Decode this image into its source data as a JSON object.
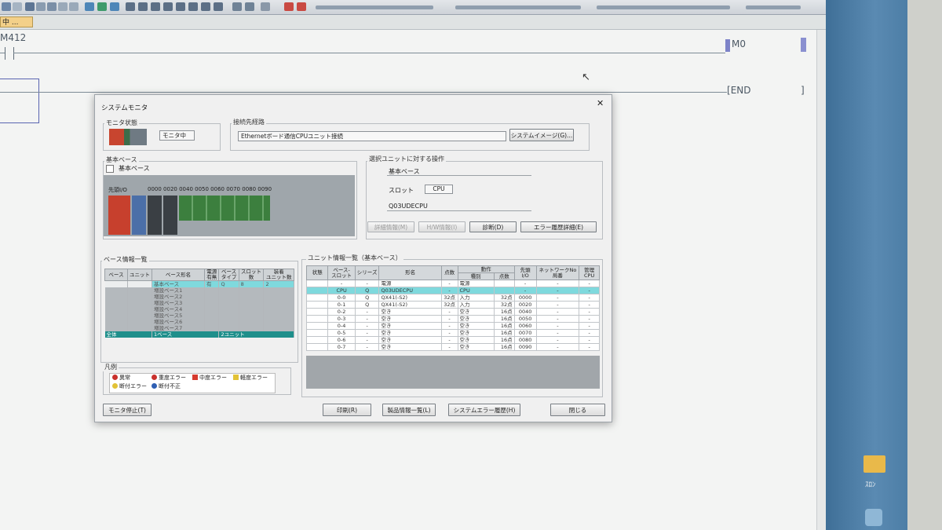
{
  "ladder": {
    "contact_label": "M412",
    "coil_label": "M0",
    "end_label": "END"
  },
  "tab": {
    "label": "中 ..."
  },
  "dialog": {
    "title": "システムモニタ",
    "close_glyph": "✕",
    "monitor_status": {
      "title": "モニタ状態",
      "value": "モニタ中"
    },
    "connection": {
      "title": "接続先経路",
      "value": "Ethernetボード通信CPUユニット接続",
      "button": "システムイメージ(G)..."
    },
    "base": {
      "title": "基本ベース",
      "checkbox_label": "基本ベース",
      "io_label": "先頭I/O",
      "io_addresses": "0000 0020 0040 0050 0060 0070 0080 0090"
    },
    "operation": {
      "title": "選択ユニットに対する操作",
      "base_name": "基本ベース",
      "slot_label": "スロット",
      "slot_value": "CPU",
      "model": "Q03UDECPU",
      "buttons": {
        "detail": "詳細情報(M)",
        "hw": "H/W情報(I)",
        "diagnose": "診断(D)",
        "error_history": "エラー履歴詳細(E)"
      }
    },
    "base_list": {
      "title": "ベース情報一覧",
      "headers": [
        "ベース",
        "ユニット",
        "ベース形名",
        "電源\n有無",
        "ベース\nタイプ",
        "スロット\n数",
        "装着\nユニット数"
      ],
      "rows": [
        [
          "",
          "",
          "基本ベース",
          "有",
          "Q",
          "8",
          "2"
        ],
        [
          "",
          "",
          "増設ベース1",
          "",
          "",
          "",
          ""
        ],
        [
          "",
          "",
          "増設ベース2",
          "",
          "",
          "",
          ""
        ],
        [
          "",
          "",
          "増設ベース3",
          "",
          "",
          "",
          ""
        ],
        [
          "",
          "",
          "増設ベース4",
          "",
          "",
          "",
          ""
        ],
        [
          "",
          "",
          "増設ベース5",
          "",
          "",
          "",
          ""
        ],
        [
          "",
          "",
          "増設ベース6",
          "",
          "",
          "",
          ""
        ],
        [
          "",
          "",
          "増設ベース7",
          "",
          "",
          "",
          ""
        ]
      ],
      "total_row": {
        "label": "全体",
        "base_count": "1ベース",
        "unit_count": "2ユニット"
      }
    },
    "unit_list": {
      "title": "ユニット情報一覧（基本ベース）",
      "headers": {
        "status": "状態",
        "slot": "ベース-\nスロット",
        "series": "シリーズ",
        "model": "形名",
        "points": "点数",
        "action": "動作",
        "action_type": "種別",
        "action_points": "点数",
        "head_io": "先頭\nI/O",
        "network": "ネットワークNo\n局番",
        "cpu": "管理\nCPU"
      },
      "rows": [
        [
          "",
          "-",
          "-",
          "電源",
          "-",
          "電源",
          "",
          "-",
          "-",
          "-"
        ],
        [
          "",
          "CPU",
          "Q",
          "Q03UDECPU",
          "-",
          "CPU",
          "",
          "-",
          "-",
          "-"
        ],
        [
          "",
          "0-0",
          "Q",
          "QX41(-S2)",
          "32点",
          "入力",
          "32点",
          "0000",
          "-",
          "-"
        ],
        [
          "",
          "0-1",
          "Q",
          "QX41(-S2)",
          "32点",
          "入力",
          "32点",
          "0020",
          "-",
          "-"
        ],
        [
          "",
          "0-2",
          "-",
          "空き",
          "-",
          "空き",
          "16点",
          "0040",
          "-",
          "-"
        ],
        [
          "",
          "0-3",
          "-",
          "空き",
          "-",
          "空き",
          "16点",
          "0050",
          "-",
          "-"
        ],
        [
          "",
          "0-4",
          "-",
          "空き",
          "-",
          "空き",
          "16点",
          "0060",
          "-",
          "-"
        ],
        [
          "",
          "0-5",
          "-",
          "空き",
          "-",
          "空き",
          "16点",
          "0070",
          "-",
          "-"
        ],
        [
          "",
          "0-6",
          "-",
          "空き",
          "-",
          "空き",
          "16点",
          "0080",
          "-",
          "-"
        ],
        [
          "",
          "0-7",
          "-",
          "空き",
          "-",
          "空き",
          "16点",
          "0090",
          "-",
          "-"
        ]
      ]
    },
    "legend": {
      "title": "凡例",
      "items": [
        "異常",
        "重度エラー",
        "中度エラー",
        "軽度エラー",
        "断付エラー",
        "断付不正"
      ]
    },
    "buttons": {
      "stop_monitor": "モニタ停止(T)",
      "print": "印刷(R)",
      "product_list": "製品情報一覧(L)",
      "system_error": "システムエラー履歴(H)",
      "close": "閉じる"
    }
  },
  "desktop": {
    "folder_label": "ｽﾛﾝ"
  }
}
